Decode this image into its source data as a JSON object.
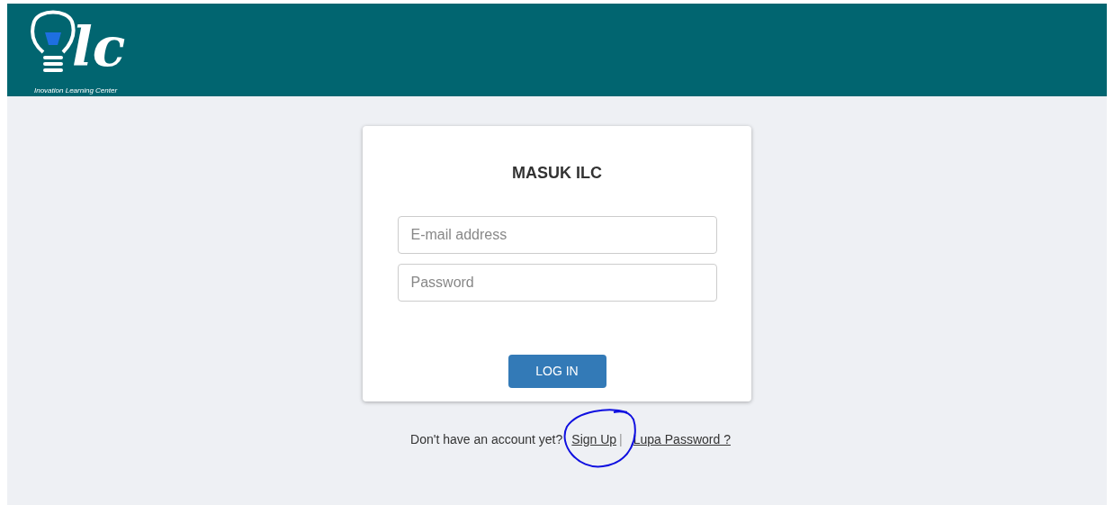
{
  "header": {
    "logo_text": "lc",
    "tagline": "Inovation Learning Center"
  },
  "login_card": {
    "title": "MASUK ILC",
    "email": {
      "placeholder": "E-mail address"
    },
    "password": {
      "placeholder": "Password"
    },
    "submit": "LOG IN"
  },
  "footer": {
    "prompt": "Don't have an account yet?",
    "signup_link": "Sign Up",
    "separator": "|",
    "forgot_link": "Lupa Password ?"
  }
}
